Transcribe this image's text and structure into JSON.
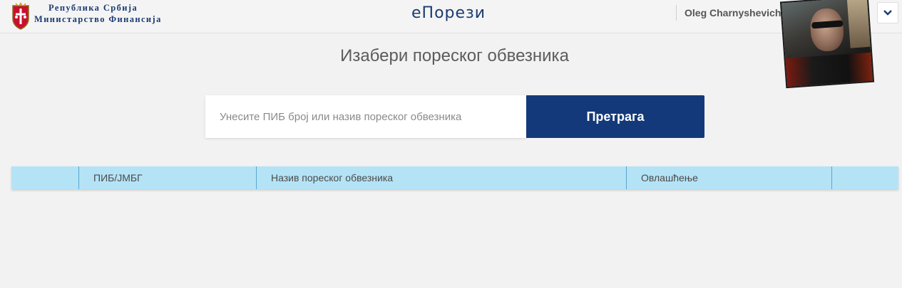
{
  "header": {
    "ministry_line1": "Република Србија",
    "ministry_line2": "Министарство Финансија",
    "brand": "еПорези",
    "user_name": "Oleg Charnyshevich",
    "menu_icon": "chevron-down-icon"
  },
  "main": {
    "title": "Изабери пореског обвезника",
    "search": {
      "placeholder": "Унесите ПИБ број или назив пореског обвезника",
      "value": "",
      "button_label": "Претрага"
    },
    "table": {
      "columns": [
        "",
        "ПИБ/ЈМБГ",
        "Назив пореског обвезника",
        "Овлашћење",
        ""
      ]
    }
  },
  "colors": {
    "brand_blue": "#13397a",
    "table_header": "#b5e3f6",
    "background": "#f2f2f2"
  }
}
